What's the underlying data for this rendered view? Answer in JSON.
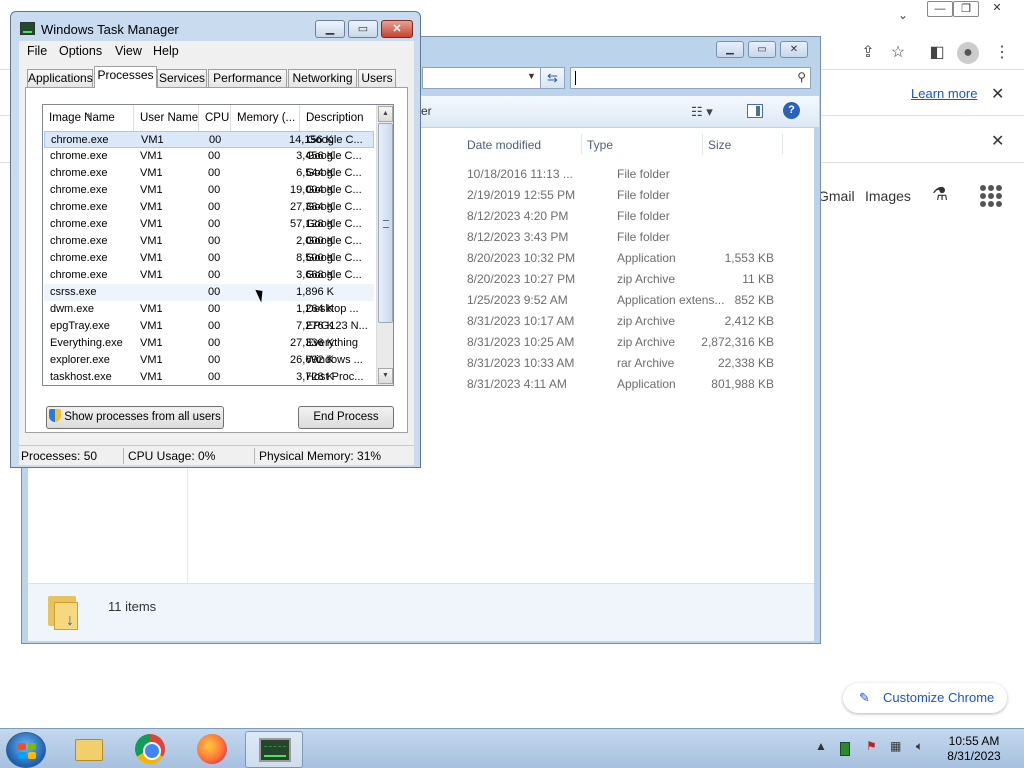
{
  "chrome": {
    "learn_more": "Learn more",
    "gmail": "Gmail",
    "images": "Images",
    "customize": "Customize Chrome"
  },
  "explorer": {
    "partial_cmd": "er",
    "columns": [
      "Date modified",
      "Type",
      "Size"
    ],
    "rows": [
      {
        "date": "10/18/2016 11:13 ...",
        "type": "File folder",
        "size": ""
      },
      {
        "date": "2/19/2019 12:55 PM",
        "type": "File folder",
        "size": ""
      },
      {
        "date": "8/12/2023 4:20 PM",
        "type": "File folder",
        "size": ""
      },
      {
        "date": "8/12/2023 3:43 PM",
        "type": "File folder",
        "size": ""
      },
      {
        "date": "8/20/2023 10:32 PM",
        "type": "Application",
        "size": "1,553 KB"
      },
      {
        "date": "8/20/2023 10:27 PM",
        "type": "zip Archive",
        "size": "11 KB"
      },
      {
        "date": "1/25/2023 9:52 AM",
        "type": "Application extens...",
        "size": "852 KB"
      },
      {
        "date": "8/31/2023 10:17 AM",
        "type": "zip Archive",
        "size": "2,412 KB"
      },
      {
        "date": "8/31/2023 10:25 AM",
        "type": "zip Archive",
        "size": "2,872,316 KB"
      },
      {
        "date": "8/31/2023 10:33 AM",
        "type": "rar Archive",
        "size": "22,338 KB"
      },
      {
        "date": "8/31/2023 4:11 AM",
        "type": "Application",
        "size": "801,988 KB"
      }
    ],
    "status_count": "11 items"
  },
  "taskmgr": {
    "title": "Windows Task Manager",
    "menu": [
      "File",
      "Options",
      "View",
      "Help"
    ],
    "tabs": [
      "Applications",
      "Processes",
      "Services",
      "Performance",
      "Networking",
      "Users"
    ],
    "active_tab": "Processes",
    "columns": [
      "Image Name",
      "User Name",
      "CPU",
      "Memory (...",
      "Description"
    ],
    "processes": [
      {
        "name": "chrome.exe",
        "user": "VM1",
        "cpu": "00",
        "mem": "14,156 K",
        "desc": "Google C..."
      },
      {
        "name": "chrome.exe",
        "user": "VM1",
        "cpu": "00",
        "mem": "3,456 K",
        "desc": "Google C..."
      },
      {
        "name": "chrome.exe",
        "user": "VM1",
        "cpu": "00",
        "mem": "6,544 K",
        "desc": "Google C..."
      },
      {
        "name": "chrome.exe",
        "user": "VM1",
        "cpu": "00",
        "mem": "19,004 K",
        "desc": "Google C..."
      },
      {
        "name": "chrome.exe",
        "user": "VM1",
        "cpu": "00",
        "mem": "27,384 K",
        "desc": "Google C..."
      },
      {
        "name": "chrome.exe",
        "user": "VM1",
        "cpu": "00",
        "mem": "57,128 K",
        "desc": "Google C..."
      },
      {
        "name": "chrome.exe",
        "user": "VM1",
        "cpu": "00",
        "mem": "2,000 K",
        "desc": "Google C..."
      },
      {
        "name": "chrome.exe",
        "user": "VM1",
        "cpu": "00",
        "mem": "8,500 K",
        "desc": "Google C..."
      },
      {
        "name": "chrome.exe",
        "user": "VM1",
        "cpu": "00",
        "mem": "3,668 K",
        "desc": "Google C..."
      },
      {
        "name": "csrss.exe",
        "user": "",
        "cpu": "00",
        "mem": "1,896 K",
        "desc": ""
      },
      {
        "name": "dwm.exe",
        "user": "VM1",
        "cpu": "00",
        "mem": "1,264 K",
        "desc": "Desktop ..."
      },
      {
        "name": "epgTray.exe",
        "user": "VM1",
        "cpu": "00",
        "mem": "7,276 K",
        "desc": "EPG123 N..."
      },
      {
        "name": "Everything.exe",
        "user": "VM1",
        "cpu": "00",
        "mem": "27,336 K",
        "desc": "Everything"
      },
      {
        "name": "explorer.exe",
        "user": "VM1",
        "cpu": "00",
        "mem": "26,692 K",
        "desc": "Windows ..."
      },
      {
        "name": "taskhost.exe",
        "user": "VM1",
        "cpu": "00",
        "mem": "3,728 K",
        "desc": "Host Proc..."
      }
    ],
    "show_all_btn": "Show processes from all users",
    "end_process_btn": "End Process",
    "status": {
      "processes": "Processes: 50",
      "cpu": "CPU Usage: 0%",
      "memory": "Physical Memory: 31%"
    }
  },
  "taskbar": {
    "time": "10:55 AM",
    "date": "8/31/2023"
  }
}
